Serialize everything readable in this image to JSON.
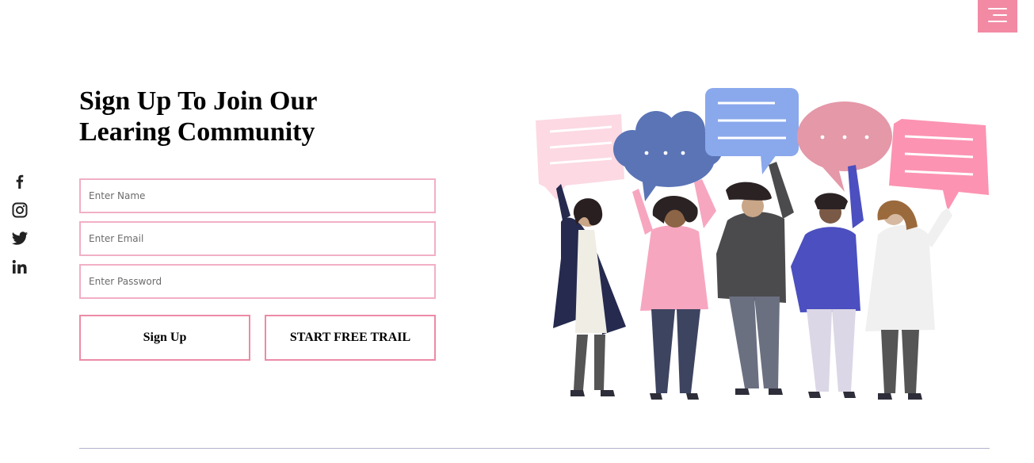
{
  "header": {
    "menu_icon": "hamburger-menu-icon",
    "accent": "#f28aa4"
  },
  "social": {
    "icons": [
      "facebook-icon",
      "instagram-icon",
      "twitter-icon",
      "linkedin-icon"
    ]
  },
  "signup": {
    "title_line1": "Sign Up To Join Our",
    "title_line2": "Learing Community",
    "name_placeholder": "Enter Name",
    "email_placeholder": "Enter Email",
    "password_placeholder": "Enter Password",
    "signup_label": "Sign Up",
    "trial_label": "START FREE TRAIL"
  },
  "colors": {
    "field_border": "#f1afc6",
    "button_border": "#ec8ba6",
    "divider": "#b3b3cf"
  }
}
